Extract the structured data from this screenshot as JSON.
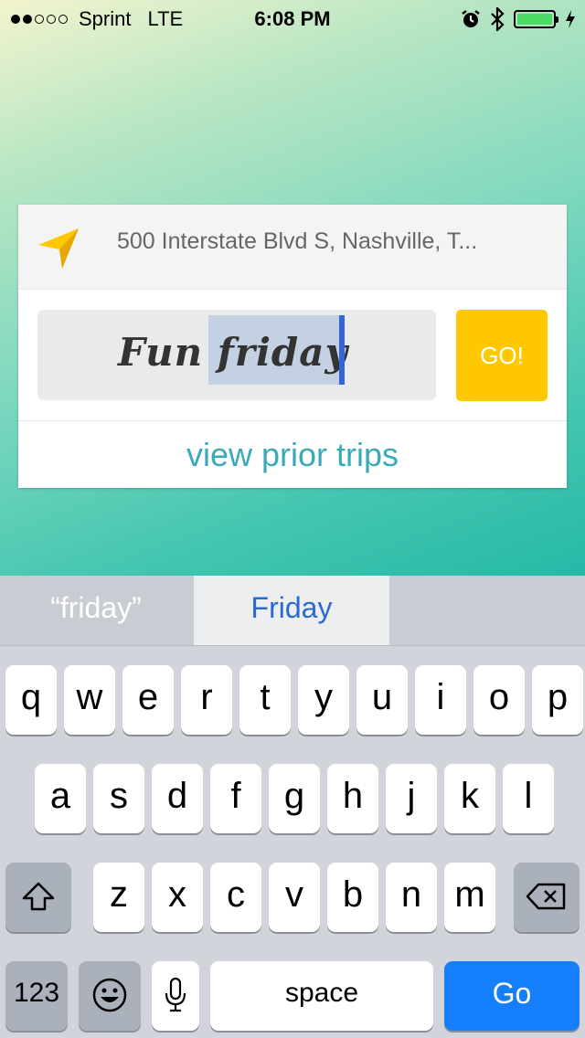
{
  "status_bar": {
    "carrier": "Sprint",
    "network": "LTE",
    "time": "6:08 PM",
    "signal_bars_filled": 2,
    "signal_bars_total": 5,
    "battery_level": 1.0
  },
  "location": {
    "icon": "location-arrow-icon",
    "address": "500 Interstate Blvd S, Nashville, T..."
  },
  "trip_name": {
    "value_prefix": "Fun ",
    "value_selected": "friday"
  },
  "go_button": {
    "label": "GO!",
    "color": "#ffc800"
  },
  "prior_trips_link": "view prior trips",
  "keyboard": {
    "suggestions": [
      "“friday”",
      "Friday",
      ""
    ],
    "rows": [
      [
        "q",
        "w",
        "e",
        "r",
        "t",
        "y",
        "u",
        "i",
        "o",
        "p"
      ],
      [
        "a",
        "s",
        "d",
        "f",
        "g",
        "h",
        "j",
        "k",
        "l"
      ],
      [
        "z",
        "x",
        "c",
        "v",
        "b",
        "n",
        "m"
      ]
    ],
    "numbers_label": "123",
    "space_label": "space",
    "go_label": "Go",
    "shift_icon": "shift-icon",
    "delete_icon": "delete-icon",
    "emoji_icon": "emoji-icon",
    "mic_icon": "microphone-icon"
  }
}
